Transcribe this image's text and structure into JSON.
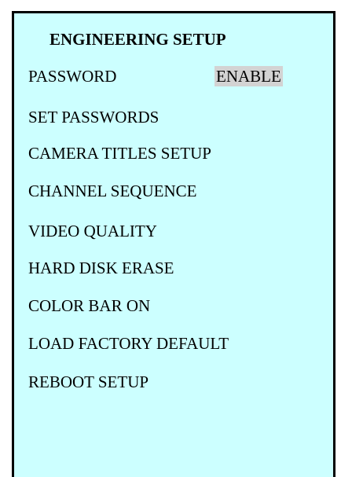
{
  "menu": {
    "title": "ENGINEERING SETUP",
    "password_label": "PASSWORD",
    "password_value": "ENABLE",
    "items": [
      "SET PASSWORDS",
      "CAMERA TITLES SETUP",
      "CHANNEL SEQUENCE",
      "VIDEO QUALITY",
      "HARD DISK ERASE",
      "COLOR BAR ON",
      "LOAD FACTORY DEFAULT",
      "REBOOT SETUP"
    ]
  },
  "colors": {
    "background": "#ccffff",
    "border": "#000000",
    "selection_highlight": "#d3d3d3",
    "text": "#000000"
  }
}
